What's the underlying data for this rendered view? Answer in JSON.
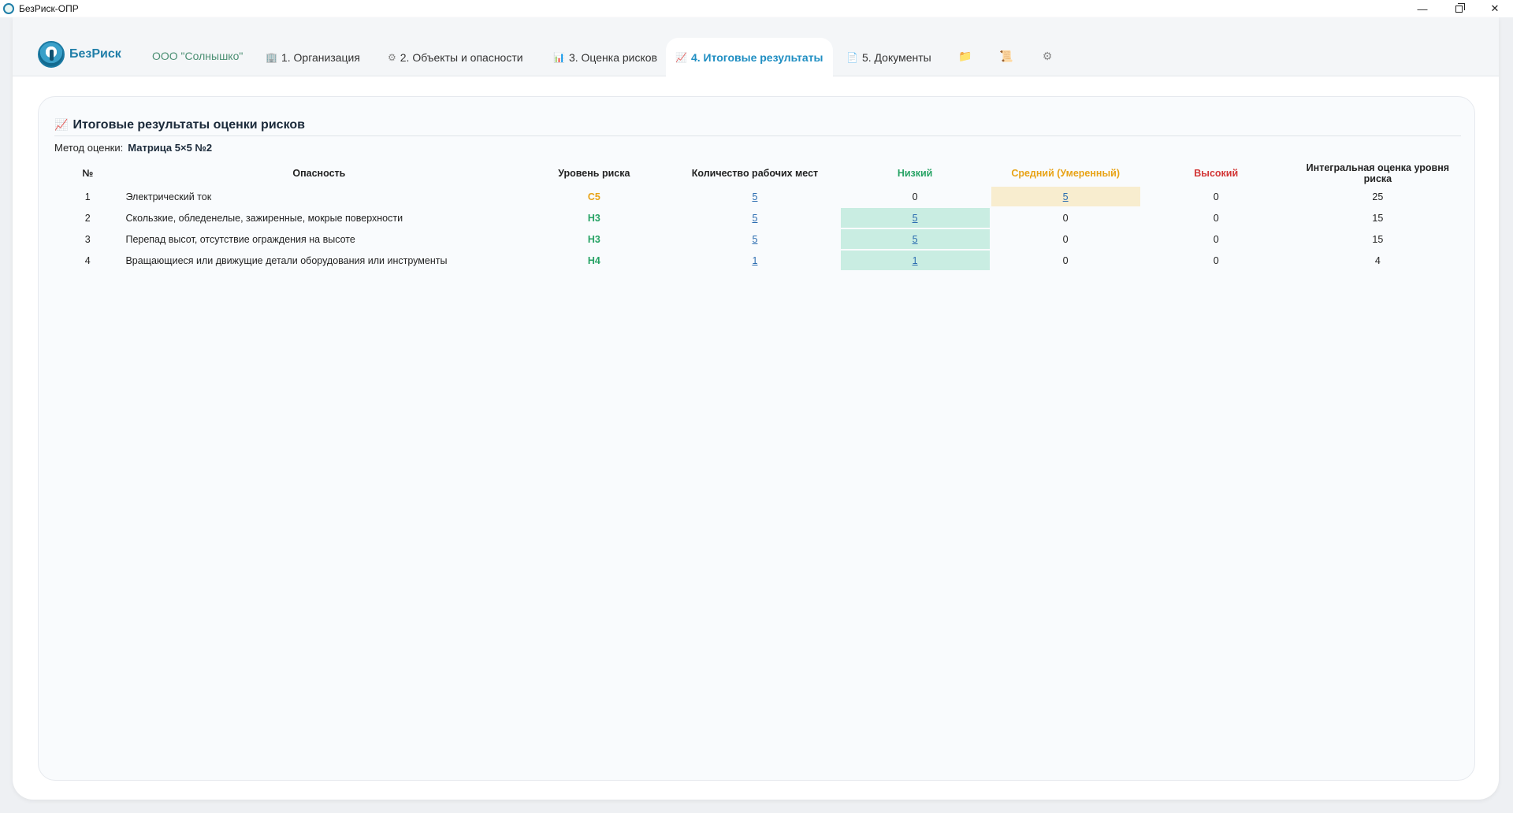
{
  "window": {
    "title": "БезРиск-ОПР",
    "minimize": "—",
    "close": "✕"
  },
  "navbar": {
    "logo_text": "БезРиск",
    "org_name": "ООО \"Солнышко\"",
    "tabs": [
      {
        "icon": "🏢",
        "label": "1. Организация"
      },
      {
        "icon": "⚙",
        "label": "2. Объекты и опасности"
      },
      {
        "icon": "📊",
        "label": "3. Оценка рисков"
      },
      {
        "icon": "📈",
        "label": "4. Итоговые результаты"
      },
      {
        "icon": "📄",
        "label": "5. Документы"
      }
    ],
    "icon_buttons": [
      "folder-icon",
      "scroll-icon",
      "gear-icon"
    ]
  },
  "panel": {
    "icon": "📈",
    "title": "Итоговые результаты оценки рисков",
    "method_label": "Метод оценки:",
    "method_value": "Матрица 5×5 №2"
  },
  "table": {
    "headers": {
      "num": "№",
      "hazard": "Опасность",
      "level": "Уровень риска",
      "workplaces": "Количество рабочих мест",
      "low": "Низкий",
      "mid": "Средний (Умеренный)",
      "high": "Высокий",
      "integral": "Интегральная оценка уровня риска"
    },
    "rows": [
      {
        "num": "1",
        "hazard": "Электрический ток",
        "level": "С5",
        "workplaces": "5",
        "low": "0",
        "mid": "5",
        "high": "0",
        "integral": "25"
      },
      {
        "num": "2",
        "hazard": "Скользкие, обледенелые, зажиренные, мокрые поверхности",
        "level": "Н3",
        "workplaces": "5",
        "low": "5",
        "mid": "0",
        "high": "0",
        "integral": "15"
      },
      {
        "num": "3",
        "hazard": "Перепад высот, отсутствие ограждения на высоте",
        "level": "Н3",
        "workplaces": "5",
        "low": "5",
        "mid": "0",
        "high": "0",
        "integral": "15"
      },
      {
        "num": "4",
        "hazard": "Вращающиеся или движущие детали оборудования или инструменты",
        "level": "Н4",
        "workplaces": "1",
        "low": "1",
        "mid": "0",
        "high": "0",
        "integral": "4"
      }
    ]
  },
  "colors": {
    "accent": "#1f8ec2",
    "low": "#27a365",
    "mid": "#e8a317",
    "high": "#d23535",
    "low_fill": "#c9ede2",
    "mid_fill": "#f8edcf"
  }
}
